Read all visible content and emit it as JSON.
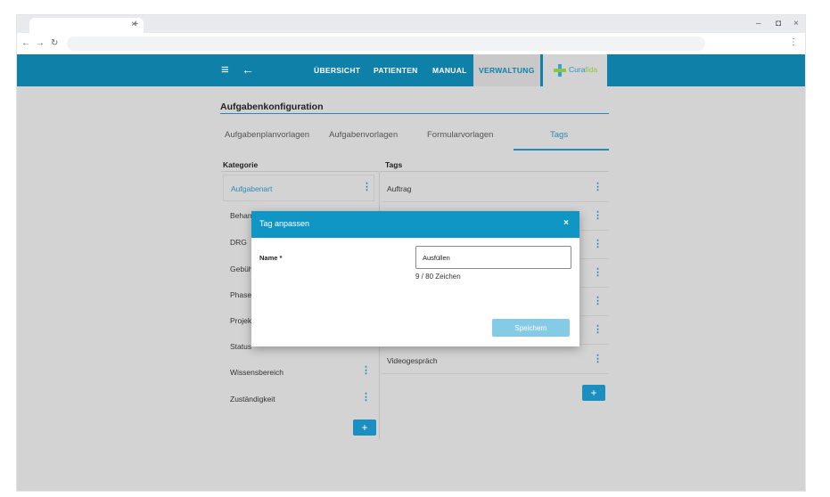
{
  "browser": {
    "tab_close": "×",
    "new_tab": "+",
    "window_controls": [
      "–",
      "◘",
      "×"
    ],
    "nav": [
      "←",
      "→",
      "↻"
    ],
    "menu": "⋮"
  },
  "appbar": {
    "menu_icon": "≡",
    "back_icon": "←",
    "nav_items": [
      "ÜBERSICHT",
      "PATIENTEN",
      "MANUAL",
      "VERWALTUNG"
    ],
    "logo_text_primary": "Cura",
    "logo_text_secondary": "fida",
    "colors": {
      "bar": "#0f80a8",
      "accent": "#2a8ab5"
    }
  },
  "page": {
    "title": "Aufgabenkonfiguration",
    "tabs": [
      "Aufgabenplanvorlagen",
      "Aufgabenvorlagen",
      "Formularvorlagen",
      "Tags"
    ],
    "active_tab": "Tags"
  },
  "kategorie": {
    "header": "Kategorie",
    "items": [
      "Aufgabenart",
      "Behan",
      "DRG",
      "Gebüh",
      "Phase",
      "Projek",
      "Status",
      "Wissensbereich",
      "Zuständigkeit"
    ],
    "add_label": "+"
  },
  "tags": {
    "header": "Tags",
    "items": [
      "Auftrag",
      "",
      "",
      "",
      "",
      "",
      "Videogespräch"
    ],
    "add_label": "+"
  },
  "modal": {
    "title": "Tag anpassen",
    "close": "×",
    "name_label": "Name *",
    "name_value": "Ausfüllen",
    "char_count": "9 / 80 Zeichen",
    "save_label": "Speichern"
  },
  "icons": {
    "kebab": "⋮"
  }
}
